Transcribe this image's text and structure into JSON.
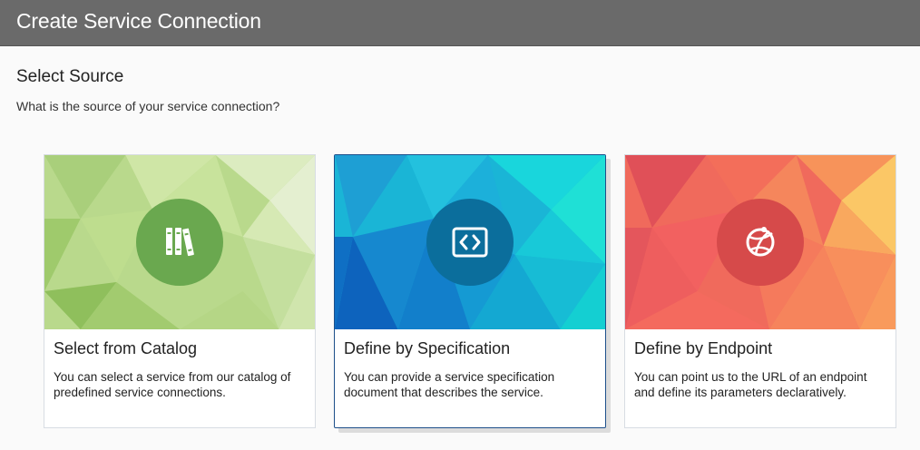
{
  "header": {
    "title": "Create Service Connection"
  },
  "section": {
    "title": "Select Source",
    "subtitle": "What is the source of your service connection?"
  },
  "cards": [
    {
      "title": "Select from Catalog",
      "description": "You can select a service from our catalog of predefined service connections.",
      "icon": "books-icon",
      "accent": "#6aa84f",
      "selected": false
    },
    {
      "title": "Define by Specification",
      "description": "You can provide a service specification document that describes the service.",
      "icon": "code-icon",
      "accent": "#0b6e9c",
      "selected": true
    },
    {
      "title": "Define by Endpoint",
      "description": "You can point us to the URL of an endpoint and define its parameters declaratively.",
      "icon": "globe-icon",
      "accent": "#d64a4a",
      "selected": false
    }
  ]
}
